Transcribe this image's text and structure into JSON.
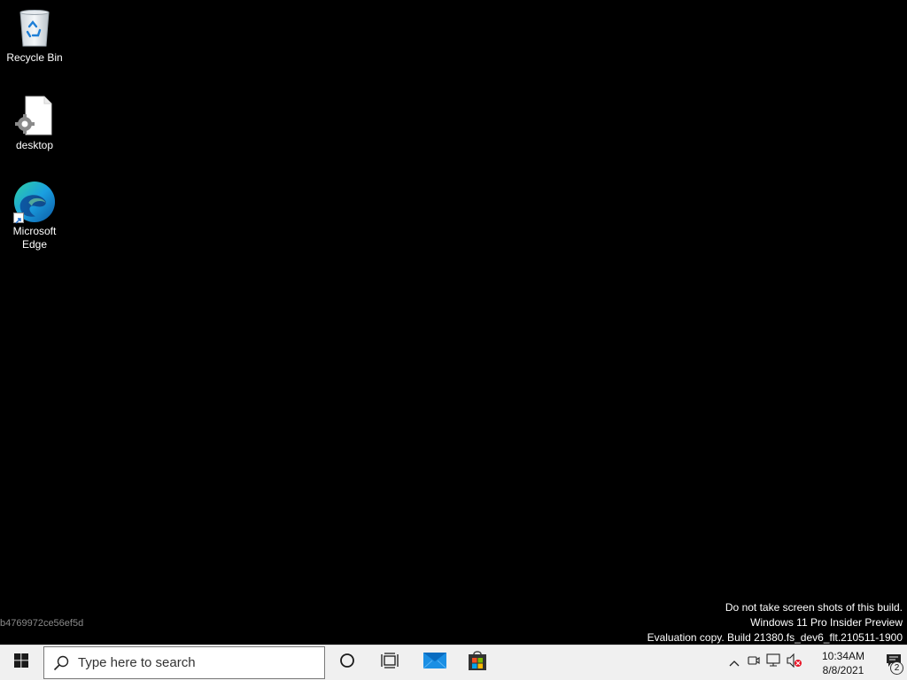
{
  "desktop": {
    "background": "#000000",
    "icons": [
      {
        "label": "Recycle Bin",
        "icon": "recycle-bin-icon"
      },
      {
        "label": "desktop",
        "icon": "settings-file-icon"
      },
      {
        "label": "Microsoft Edge",
        "icon": "edge-icon"
      }
    ],
    "hash_text": "b4769972ce56ef5d",
    "watermark": {
      "line1": "Do not take screen shots of this build.",
      "line2": "Windows 11 Pro Insider Preview",
      "line3": "Evaluation copy. Build 21380.fs_dev6_flt.210511-1900"
    }
  },
  "taskbar": {
    "background": "#f0f0f0",
    "search": {
      "placeholder": "Type here to search"
    },
    "pinned": [
      "start-icon",
      "cortana-icon",
      "task-view-icon",
      "mail-icon",
      "store-icon"
    ],
    "tray": {
      "time": "10:34AM",
      "date": "8/8/2021",
      "notification_count": "2"
    }
  }
}
